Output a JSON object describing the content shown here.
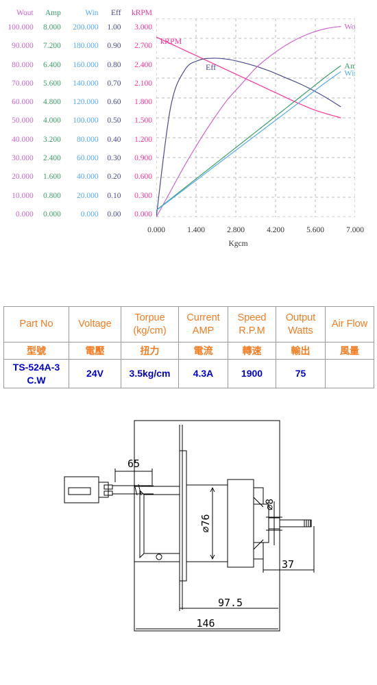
{
  "chart": {
    "column_headers": [
      "Wout",
      "Amp",
      "Win",
      "Eff",
      "kRPM"
    ],
    "xlabel": "Kgcm",
    "xticks": [
      "0.000",
      "1.400",
      "2.800",
      "4.200",
      "5.600",
      "7.000"
    ],
    "curve_labels": {
      "krpm": "kRPM",
      "eff": "Eff",
      "wout": "Wout",
      "amp": "Amp",
      "win": "Win"
    },
    "colors": {
      "wout": "#cc66cc",
      "amp": "#3aa06a",
      "win": "#55aaee",
      "eff": "#4a4a8c",
      "krpm": "#ff3399",
      "grid": "#bbbbbb"
    },
    "rows": [
      {
        "wout": "100.000",
        "amp": "8.000",
        "win": "200.000",
        "eff": "1.00",
        "krpm": "3.000"
      },
      {
        "wout": "90.000",
        "amp": "7.200",
        "win": "180.000",
        "eff": "0.90",
        "krpm": "2.700"
      },
      {
        "wout": "80.000",
        "amp": "6.400",
        "win": "160.000",
        "eff": "0.80",
        "krpm": "2.400"
      },
      {
        "wout": "70.000",
        "amp": "5.600",
        "win": "140.000",
        "eff": "0.70",
        "krpm": "2.100"
      },
      {
        "wout": "60.000",
        "amp": "4.800",
        "win": "120.000",
        "eff": "0.60",
        "krpm": "1.800"
      },
      {
        "wout": "50.000",
        "amp": "4.000",
        "win": "100.000",
        "eff": "0.50",
        "krpm": "1.500"
      },
      {
        "wout": "40.000",
        "amp": "3.200",
        "win": "80.000",
        "eff": "0.40",
        "krpm": "1.200"
      },
      {
        "wout": "30.000",
        "amp": "2.400",
        "win": "60.000",
        "eff": "0.30",
        "krpm": "0.900"
      },
      {
        "wout": "20.000",
        "amp": "1.600",
        "win": "40.000",
        "eff": "0.20",
        "krpm": "0.600"
      },
      {
        "wout": "10.000",
        "amp": "0.800",
        "win": "20.000",
        "eff": "0.10",
        "krpm": "0.300"
      },
      {
        "wout": "0.000",
        "amp": "0.000",
        "win": "0.000",
        "eff": "0.00",
        "krpm": "0.000"
      }
    ]
  },
  "chart_data": {
    "type": "line",
    "title": "",
    "xlabel": "Kgcm",
    "xlim": [
      0,
      7
    ],
    "xticks": [
      0,
      1.4,
      2.8,
      4.2,
      5.6,
      7.0
    ],
    "grid": true,
    "legend_position": "inline-curve-labels",
    "axes": [
      {
        "name": "Wout",
        "unit": "W",
        "range": [
          0,
          100
        ],
        "ticks": [
          0,
          10,
          20,
          30,
          40,
          50,
          60,
          70,
          80,
          90,
          100
        ],
        "color": "#cc66cc"
      },
      {
        "name": "Amp",
        "unit": "A",
        "range": [
          0,
          8
        ],
        "ticks": [
          0,
          0.8,
          1.6,
          2.4,
          3.2,
          4.0,
          4.8,
          5.6,
          6.4,
          7.2,
          8.0
        ],
        "color": "#3aa06a"
      },
      {
        "name": "Win",
        "unit": "W",
        "range": [
          0,
          200
        ],
        "ticks": [
          0,
          20,
          40,
          60,
          80,
          100,
          120,
          140,
          160,
          180,
          200
        ],
        "color": "#55aaee"
      },
      {
        "name": "Eff",
        "unit": "",
        "range": [
          0,
          1
        ],
        "ticks": [
          0,
          0.1,
          0.2,
          0.3,
          0.4,
          0.5,
          0.6,
          0.7,
          0.8,
          0.9,
          1.0
        ],
        "color": "#4a4a8c"
      },
      {
        "name": "kRPM",
        "unit": "kRPM",
        "range": [
          0,
          3
        ],
        "ticks": [
          0,
          0.3,
          0.6,
          0.9,
          1.2,
          1.5,
          1.8,
          2.1,
          2.4,
          2.7,
          3.0
        ],
        "color": "#ff3399"
      }
    ],
    "x": [
      0,
      0.5,
      1.0,
      1.5,
      2.0,
      2.5,
      3.0,
      3.5,
      4.0,
      4.5,
      5.0,
      5.5,
      6.0,
      6.5
    ],
    "series": [
      {
        "name": "kRPM",
        "axis": "kRPM",
        "color": "#ff3399",
        "unit": "kRPM",
        "values": [
          2.72,
          2.62,
          2.52,
          2.42,
          2.32,
          2.22,
          2.12,
          2.02,
          1.92,
          1.82,
          1.72,
          1.63,
          1.56,
          1.5
        ]
      },
      {
        "name": "Eff",
        "axis": "Eff",
        "color": "#4a4a8c",
        "unit": "",
        "values": [
          0.0,
          0.55,
          0.74,
          0.79,
          0.8,
          0.795,
          0.78,
          0.76,
          0.735,
          0.705,
          0.675,
          0.64,
          0.6,
          0.555
        ]
      },
      {
        "name": "Wout",
        "axis": "Wout",
        "color": "#cc66cc",
        "unit": "W",
        "values": [
          0,
          13,
          26,
          38,
          49,
          59,
          67,
          75,
          81,
          86,
          90,
          93,
          95,
          96
        ]
      },
      {
        "name": "Amp",
        "axis": "Amp",
        "color": "#3aa06a",
        "unit": "A",
        "values": [
          0.28,
          0.73,
          1.18,
          1.63,
          2.08,
          2.53,
          2.98,
          3.43,
          3.88,
          4.33,
          4.78,
          5.23,
          5.68,
          6.1
        ]
      },
      {
        "name": "Win",
        "axis": "Win",
        "color": "#55aaee",
        "unit": "W",
        "values": [
          6.7,
          17.5,
          28.3,
          39.1,
          50.0,
          60.8,
          71.6,
          82.4,
          93.2,
          104.0,
          114.8,
          125.6,
          136.4,
          146.5
        ]
      }
    ]
  },
  "spec_table": {
    "headers_en": [
      "Part No",
      "Voltage",
      "Torpue\n(kg/cm)",
      "Current\nAMP",
      "Speed\nR.P.M",
      "Output\nWatts",
      "Air Flow"
    ],
    "headers_en_l1": [
      "Part No",
      "Voltage",
      "Torpue",
      "Current",
      "Speed",
      "Output",
      "Air Flow"
    ],
    "headers_en_l2": [
      "",
      "",
      "(kg/cm)",
      "AMP",
      "R.P.M",
      "Watts",
      ""
    ],
    "headers_cn": [
      "型號",
      "電壓",
      "扭力",
      "電流",
      "轉速",
      "輸出",
      "風量"
    ],
    "values_l1": [
      "TS-524A-3",
      "24V",
      "3.5kg/cm",
      "4.3A",
      "1900",
      "75",
      ""
    ],
    "values_l2": [
      "C.W",
      "",
      "",
      "",
      "",
      "",
      ""
    ],
    "header_color": "#F47B20",
    "value_color": "#0000CC"
  },
  "drawing": {
    "dimensions": {
      "cable_length": "65",
      "body_diameter": "⌀76",
      "shaft_diameter": "⌀8",
      "shaft_length": "37",
      "flange_to_end": "97.5",
      "overall_length": "146"
    }
  }
}
